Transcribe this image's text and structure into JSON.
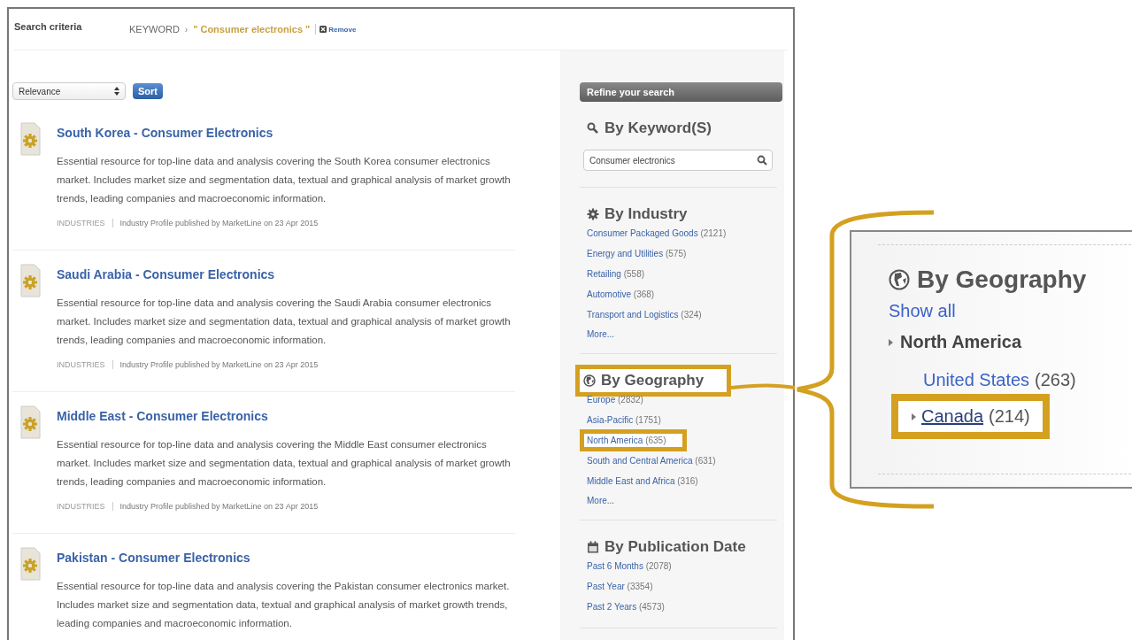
{
  "criteria": {
    "label": "Search criteria",
    "field": "KEYWORD",
    "separator": "›",
    "value": "\" Consumer electronics \"",
    "remove": "Remove"
  },
  "sort": {
    "value": "Relevance",
    "button": "Sort"
  },
  "results": [
    {
      "title": "South Korea - Consumer Electronics",
      "description": "Essential resource for top-line data and analysis covering the South Korea consumer electronics market. Includes market size and segmentation data, textual and graphical analysis of market growth trends, leading companies and macroeconomic information.",
      "category": "INDUSTRIES",
      "meta": "Industry Profile published by MarketLine on 23 Apr 2015"
    },
    {
      "title": "Saudi Arabia - Consumer Electronics",
      "description": "Essential resource for top-line data and analysis covering the Saudi Arabia consumer electronics market. Includes market size and segmentation data, textual and graphical analysis of market growth trends, leading companies and macroeconomic information.",
      "category": "INDUSTRIES",
      "meta": "Industry Profile published by MarketLine on 23 Apr 2015"
    },
    {
      "title": "Middle East - Consumer Electronics",
      "description": "Essential resource for top-line data and analysis covering the Middle East consumer electronics market. Includes market size and segmentation data, textual and graphical analysis of market growth trends, leading companies and macroeconomic information.",
      "category": "INDUSTRIES",
      "meta": "Industry Profile published by MarketLine on 23 Apr 2015"
    },
    {
      "title": "Pakistan - Consumer Electronics",
      "description": "Essential resource for top-line data and analysis covering the Pakistan consumer electronics market. Includes market size and segmentation data, textual and graphical analysis of market growth trends, leading companies and macroeconomic information."
    }
  ],
  "sidebar": {
    "header": "Refine your search",
    "sections": [
      {
        "kind": "keyword",
        "title": "By Keyword(S)",
        "value": "Consumer electronics",
        "highlighted": false
      },
      {
        "kind": "industry",
        "title": "By Industry",
        "highlighted": false,
        "items": [
          {
            "label": "Consumer Packaged Goods",
            "count": "(2121)",
            "highlighted": false
          },
          {
            "label": "Energy and Utilities",
            "count": "(575)",
            "highlighted": false
          },
          {
            "label": "Retailing",
            "count": "(558)",
            "highlighted": false
          },
          {
            "label": "Automotive",
            "count": "(368)",
            "highlighted": false
          },
          {
            "label": "Transport and Logistics",
            "count": "(324)",
            "highlighted": false
          }
        ],
        "more": "More..."
      },
      {
        "kind": "geography",
        "title": "By Geography",
        "highlighted": true,
        "items": [
          {
            "label": "Europe",
            "count": "(2832)",
            "highlighted": false
          },
          {
            "label": "Asia-Pacific",
            "count": "(1751)",
            "highlighted": false
          },
          {
            "label": "North America",
            "count": "(635)",
            "highlighted": true
          },
          {
            "label": "South and Central America",
            "count": "(631)",
            "highlighted": false
          },
          {
            "label": "Middle East and Africa",
            "count": "(316)",
            "highlighted": false
          }
        ],
        "more": "More..."
      },
      {
        "kind": "date",
        "title": "By Publication Date",
        "highlighted": false,
        "items": [
          {
            "label": "Past 6 Months",
            "count": "(2078)",
            "highlighted": false
          },
          {
            "label": "Past Year",
            "count": "(3354)",
            "highlighted": false
          },
          {
            "label": "Past 2 Years",
            "count": "(4573)",
            "highlighted": false
          }
        ]
      }
    ]
  },
  "inset": {
    "title": "By Geography",
    "show_all": "Show all",
    "region": {
      "label": "North America",
      "children": [
        {
          "label": "United States",
          "count": "(263)",
          "expandable": false,
          "hovered": false,
          "highlighted": false
        },
        {
          "label": "Canada",
          "count": "(214)",
          "expandable": true,
          "hovered": true,
          "highlighted": true
        }
      ]
    }
  }
}
